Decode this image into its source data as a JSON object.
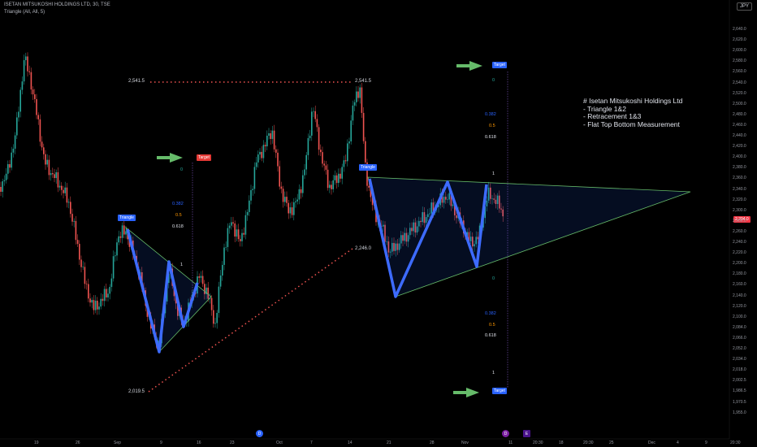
{
  "header": {
    "title": "ISETAN MITSUKOSHI HOLDINGS LTD, 30, TSE",
    "indicator": "Triangle (All, All, 5)",
    "currency": "JPY"
  },
  "note": {
    "lines": [
      "# Isetan Mitsukoshi Holdings Ltd",
      "- Triangle 1&2",
      "- Retracement 1&3",
      "- Flat Top Bottom Measurement"
    ]
  },
  "labels": {
    "triangle": "Triangle",
    "target": "Target",
    "level_high": "2,541.5",
    "level_mid": "2,246.0",
    "level_low": "2,019.5",
    "price_badge": "2,294.0"
  },
  "fib": {
    "zero": "0",
    "r382": "0.382",
    "r5": "0.5",
    "r618": "0.618",
    "one": "1"
  },
  "y_axis": [
    "2,640.0",
    "2,620.0",
    "2,600.0",
    "2,580.0",
    "2,560.0",
    "2,540.0",
    "2,520.0",
    "2,500.0",
    "2,480.0",
    "2,460.0",
    "2,440.0",
    "2,420.0",
    "2,400.0",
    "2,380.0",
    "2,360.0",
    "2,340.0",
    "2,320.0",
    "2,300.0",
    "2,280.0",
    "2,260.0",
    "2,240.0",
    "2,220.0",
    "2,200.0",
    "2,180.0",
    "2,160.0",
    "2,140.0",
    "2,120.0",
    "2,100.0",
    "2,084.0",
    "2,066.0",
    "2,052.0",
    "2,034.0",
    "2,018.0",
    "2,002.5",
    "1,986.5",
    "1,970.5",
    "1,955.0"
  ],
  "x_axis": [
    "19",
    "26",
    "Sep",
    "9",
    "16",
    "23",
    "Oct",
    "7",
    "14",
    "21",
    "28",
    "Nov",
    "11",
    "20:30",
    "18",
    "20:30",
    "25",
    "Dec",
    "4",
    "9",
    "20:30"
  ],
  "markers": {
    "earnings": "D",
    "split": "E"
  },
  "colors": {
    "bull": "#26a69a",
    "bear": "#ef5350",
    "pattern": "#3d6bff",
    "accent": "#2962ff"
  }
}
